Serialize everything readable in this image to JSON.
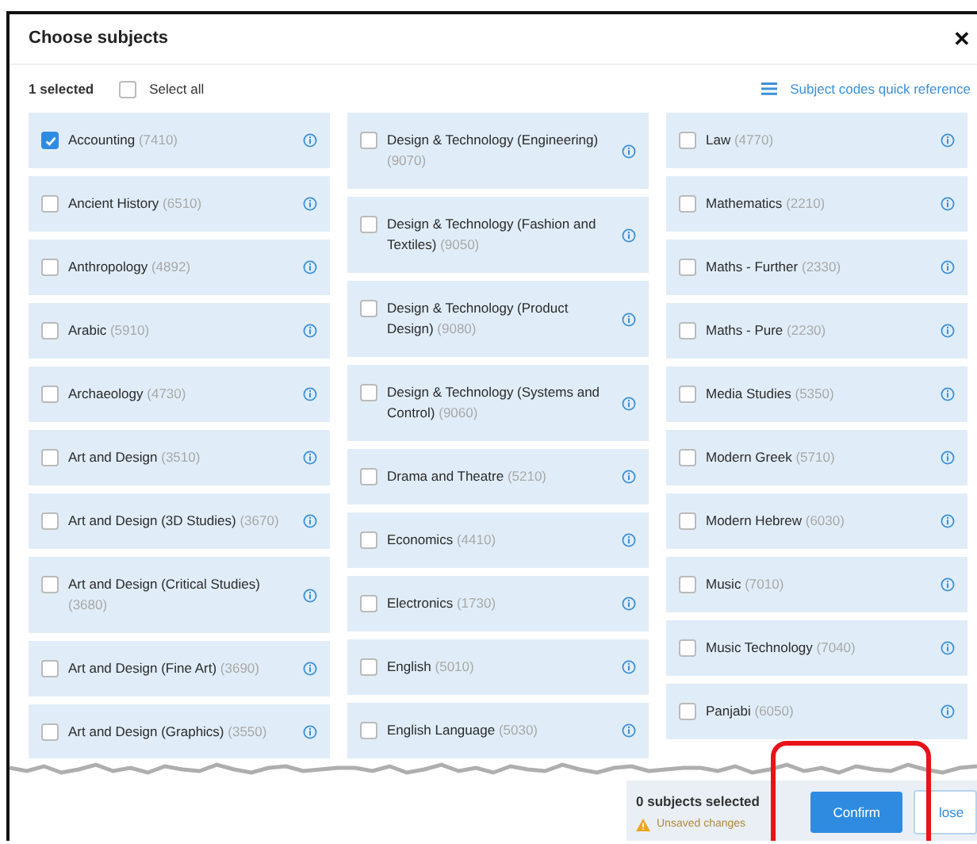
{
  "dialog": {
    "title": "Choose subjects",
    "close": "✕"
  },
  "toolbar": {
    "selected_count": "1 selected",
    "select_all": {
      "label": "Select all",
      "checked": false
    },
    "reference_link": "Subject codes quick reference"
  },
  "columns": [
    [
      {
        "name": "Accounting",
        "code": "(7410)",
        "checked": true
      },
      {
        "name": "Ancient History",
        "code": "(6510)",
        "checked": false
      },
      {
        "name": "Anthropology",
        "code": "(4892)",
        "checked": false
      },
      {
        "name": "Arabic",
        "code": "(5910)",
        "checked": false
      },
      {
        "name": "Archaeology",
        "code": "(4730)",
        "checked": false
      },
      {
        "name": "Art and Design",
        "code": "(3510)",
        "checked": false
      },
      {
        "name": "Art and Design (3D Studies)",
        "code": "(3670)",
        "checked": false
      },
      {
        "name": "Art and Design (Critical Studies)",
        "code": "(3680)",
        "checked": false
      },
      {
        "name": "Art and Design (Fine Art)",
        "code": "(3690)",
        "checked": false
      },
      {
        "name": "Art and Design (Graphics)",
        "code": "(3550)",
        "checked": false
      }
    ],
    [
      {
        "name": "Design & Technology (Engineering)",
        "code": "(9070)",
        "checked": false
      },
      {
        "name": "Design & Technology (Fashion and Textiles)",
        "code": "(9050)",
        "checked": false
      },
      {
        "name": "Design & Technology (Product Design)",
        "code": "(9080)",
        "checked": false
      },
      {
        "name": "Design & Technology (Systems and Control)",
        "code": "(9060)",
        "checked": false
      },
      {
        "name": "Drama and Theatre",
        "code": "(5210)",
        "checked": false
      },
      {
        "name": "Economics",
        "code": "(4410)",
        "checked": false
      },
      {
        "name": "Electronics",
        "code": "(1730)",
        "checked": false
      },
      {
        "name": "English",
        "code": "(5010)",
        "checked": false
      },
      {
        "name": "English Language",
        "code": "(5030)",
        "checked": false
      }
    ],
    [
      {
        "name": "Law",
        "code": "(4770)",
        "checked": false
      },
      {
        "name": "Mathematics",
        "code": "(2210)",
        "checked": false
      },
      {
        "name": "Maths - Further",
        "code": "(2330)",
        "checked": false
      },
      {
        "name": "Maths - Pure",
        "code": "(2230)",
        "checked": false
      },
      {
        "name": "Media Studies",
        "code": "(5350)",
        "checked": false
      },
      {
        "name": "Modern Greek",
        "code": "(5710)",
        "checked": false
      },
      {
        "name": "Modern Hebrew",
        "code": "(6030)",
        "checked": false
      },
      {
        "name": "Music",
        "code": "(7010)",
        "checked": false
      },
      {
        "name": "Music Technology",
        "code": "(7040)",
        "checked": false
      },
      {
        "name": "Panjabi",
        "code": "(6050)",
        "checked": false
      }
    ]
  ],
  "footer": {
    "count": "0 subjects selected",
    "warning": "Unsaved changes",
    "buttons": [
      {
        "label": "Confirm",
        "kind": "primary"
      },
      {
        "label": "lose",
        "kind": "secondary"
      }
    ]
  }
}
